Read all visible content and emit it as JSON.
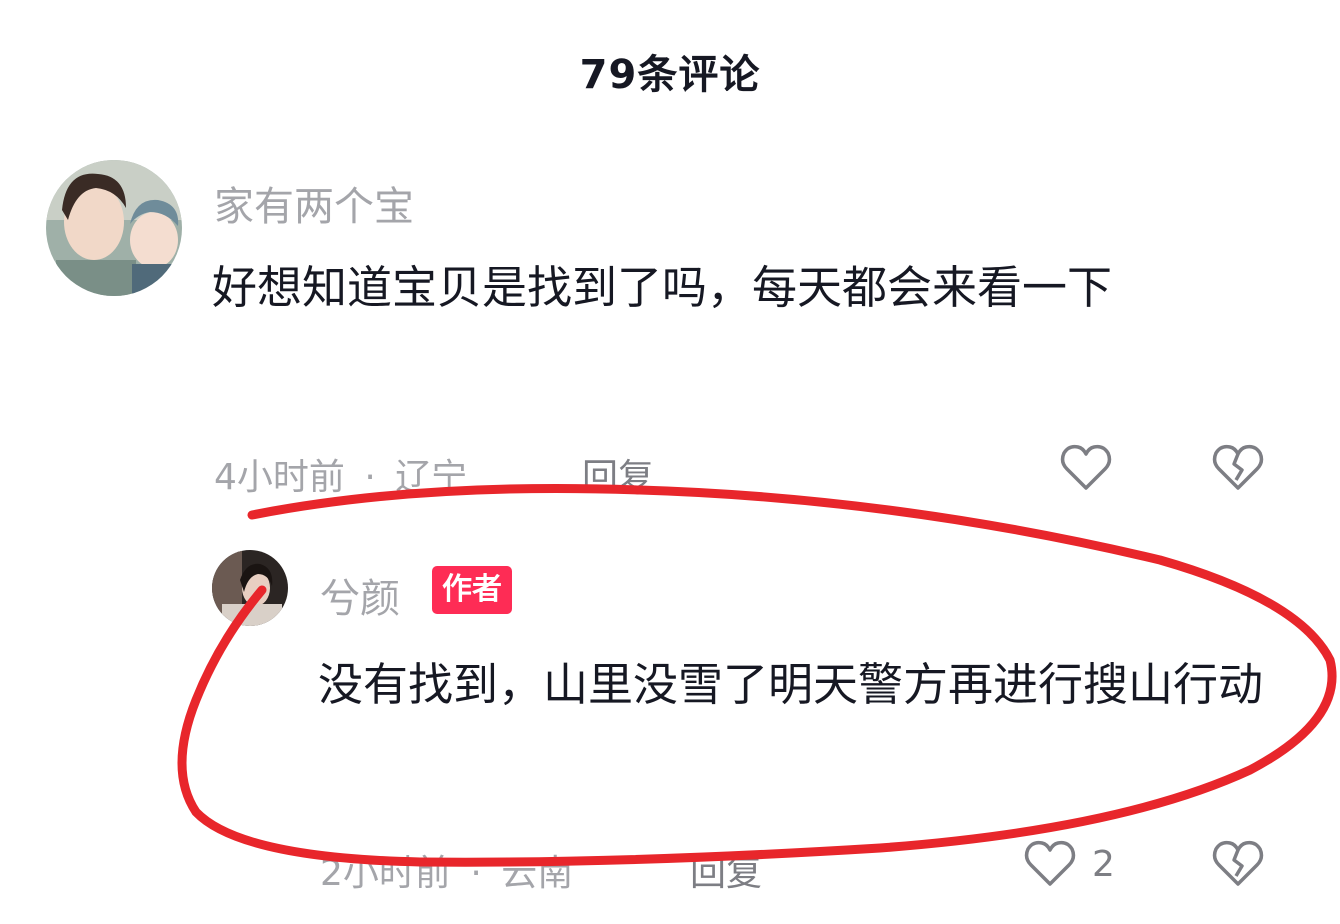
{
  "header": {
    "title": "79条评论"
  },
  "comments": [
    {
      "username": "家有两个宝",
      "text": "好想知道宝贝是找到了吗，每天都会来看一下",
      "time": "4小时前",
      "separator": "·",
      "location": "辽宁",
      "reply_label": "回复",
      "like_icon": "heart-outline-icon",
      "dislike_icon": "broken-heart-icon"
    },
    {
      "username": "兮颜",
      "badge": "作者",
      "text": "没有找到，山里没雪了明天警方再进行搜山行动",
      "time": "2小时前",
      "separator": "·",
      "location": "云南",
      "reply_label": "回复",
      "like_count": "2",
      "like_icon": "heart-outline-icon",
      "dislike_icon": "broken-heart-icon"
    }
  ],
  "colors": {
    "badge_bg": "#fe2c55",
    "annotation_stroke": "#e8262b",
    "secondary_text": "#a4a5aa"
  }
}
